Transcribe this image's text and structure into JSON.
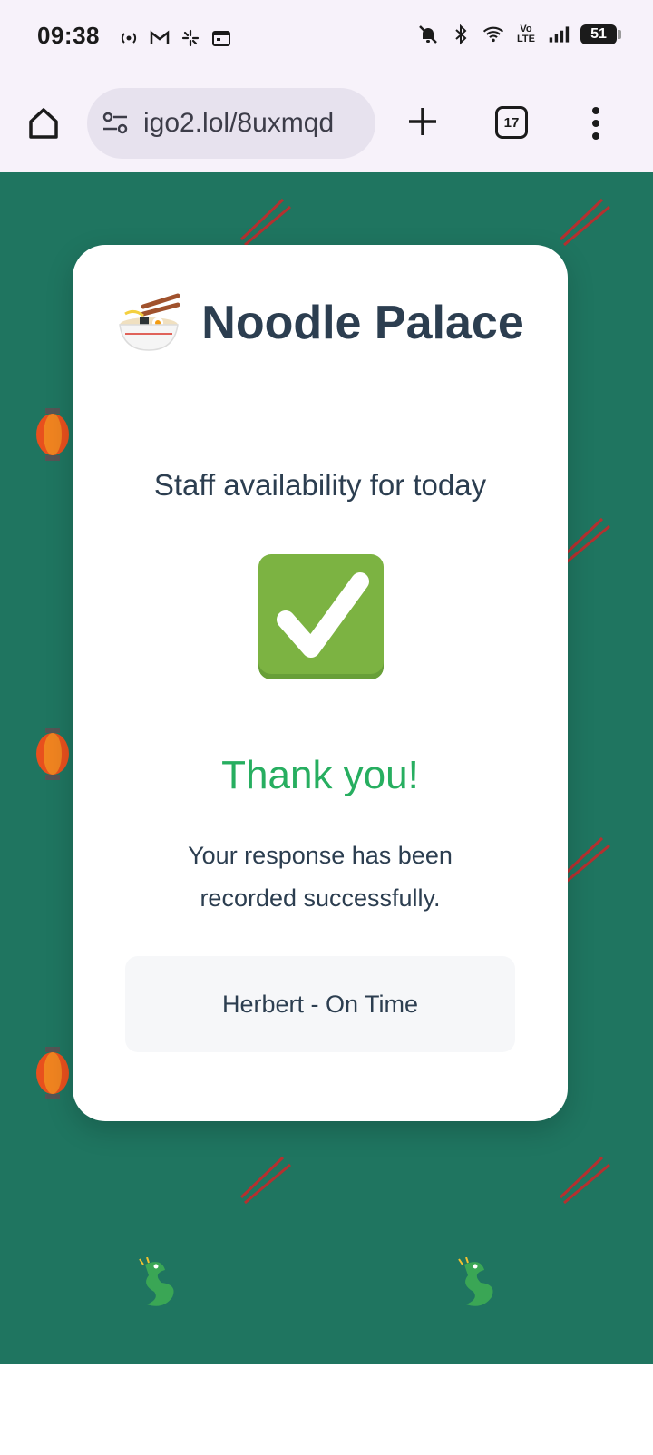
{
  "status_bar": {
    "time": "09:38",
    "battery_level": "51",
    "icons_left": [
      "broadcast-icon",
      "gmail-icon",
      "pinwheel-icon",
      "calendar-icon"
    ],
    "icons_right": [
      "bell-off-icon",
      "bluetooth-icon",
      "wifi-icon",
      "volte-icon",
      "signal-icon",
      "battery-icon"
    ]
  },
  "browser": {
    "url": "igo2.lol/8uxmqd",
    "tab_count": "17"
  },
  "card": {
    "title": "Noodle Palace",
    "subtitle": "Staff availability for today",
    "thanks": "Thank you!",
    "message": "Your response has been recorded successfully.",
    "result": "Herbert - On Time"
  },
  "colors": {
    "page_background": "#1f7560",
    "title": "#2c3e50",
    "success": "#27ae60",
    "check": "#7cb342"
  }
}
